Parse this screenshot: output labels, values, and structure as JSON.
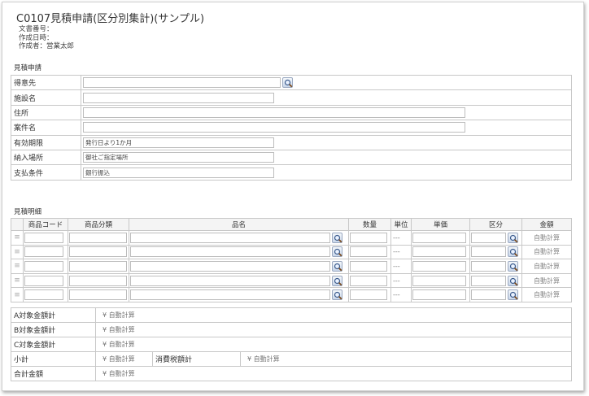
{
  "header": {
    "title": "C0107見積申請(区分別集計)(サンプル)",
    "doc_number_label": "文書番号：",
    "created_datetime_label": "作成日時：",
    "creator_label": "作成者：",
    "creator_value": "営業太郎"
  },
  "estimate_section": {
    "label": "見積申請",
    "fields": [
      {
        "label": "得意先",
        "value": ""
      },
      {
        "label": "施設名",
        "value": ""
      },
      {
        "label": "住所",
        "value": ""
      },
      {
        "label": "案件名",
        "value": ""
      },
      {
        "label": "有効期限",
        "value": "発行日より1か月"
      },
      {
        "label": "納入場所",
        "value": "御社ご指定場所"
      },
      {
        "label": "支払条件",
        "value": "銀行振込"
      }
    ]
  },
  "detail_section": {
    "label": "見積明細",
    "columns": [
      "商品コード",
      "商品分類",
      "品名",
      "数量",
      "単位",
      "単価",
      "区分",
      "金額"
    ],
    "rows": [
      {
        "unit": "---",
        "amount": "自動計算"
      },
      {
        "unit": "---",
        "amount": "自動計算"
      },
      {
        "unit": "---",
        "amount": "自動計算"
      },
      {
        "unit": "---",
        "amount": "自動計算"
      },
      {
        "unit": "---",
        "amount": "自動計算"
      }
    ]
  },
  "summary": {
    "a_label": "A対象金額計",
    "a_value": "¥ 自動計算",
    "b_label": "B対象金額計",
    "b_value": "¥ 自動計算",
    "c_label": "C対象金額計",
    "c_value": "¥ 自動計算",
    "subtotal_label": "小計",
    "subtotal_value": "¥ 自動計算",
    "tax_label": "消費税額計",
    "tax_value": "¥ 自動計算",
    "total_label": "合計金額",
    "total_value": "¥ 自動計算"
  },
  "icons": {
    "search": "search-icon",
    "drag": "drag-handle-icon"
  }
}
